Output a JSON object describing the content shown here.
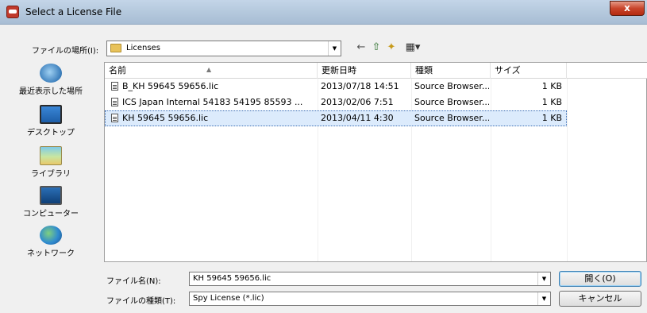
{
  "window": {
    "title": "Select a License File",
    "close_glyph": "x"
  },
  "lookin": {
    "label": "ファイルの場所(I):",
    "value": "Licenses"
  },
  "toolbar": {
    "back_glyph": "←",
    "up_glyph": "⇧",
    "newfolder_glyph": "✦",
    "views_glyph": "▦▾"
  },
  "places": [
    {
      "label": "最近表示した場所",
      "icon": "recent-places-icon"
    },
    {
      "label": "デスクトップ",
      "icon": "desktop-icon"
    },
    {
      "label": "ライブラリ",
      "icon": "library-icon"
    },
    {
      "label": "コンピューター",
      "icon": "computer-icon"
    },
    {
      "label": "ネットワーク",
      "icon": "network-icon"
    }
  ],
  "columns": {
    "name": "名前",
    "modified": "更新日時",
    "type": "種類",
    "size": "サイズ"
  },
  "files": [
    {
      "name": "B_KH 59645 59656.lic",
      "modified": "2013/07/18 14:51",
      "type": "Source Browser...",
      "size": "1 KB",
      "selected": false
    },
    {
      "name": "ICS Japan Internal 54183 54195 85593 ...",
      "modified": "2013/02/06 7:51",
      "type": "Source Browser...",
      "size": "1 KB",
      "selected": false
    },
    {
      "name": "KH 59645 59656.lic",
      "modified": "2013/04/11 4:30",
      "type": "Source Browser...",
      "size": "1 KB",
      "selected": true
    }
  ],
  "filename": {
    "label": "ファイル名(N):",
    "value": "KH 59645 59656.lic"
  },
  "filetype": {
    "label": "ファイルの種類(T):",
    "value": "Spy License (*.lic)"
  },
  "buttons": {
    "open": "開く(O)",
    "cancel": "キャンセル"
  },
  "colors": {
    "selection": "#dcebfc",
    "title_gradient_top": "#c4d5e8",
    "close_red": "#c9452b"
  }
}
